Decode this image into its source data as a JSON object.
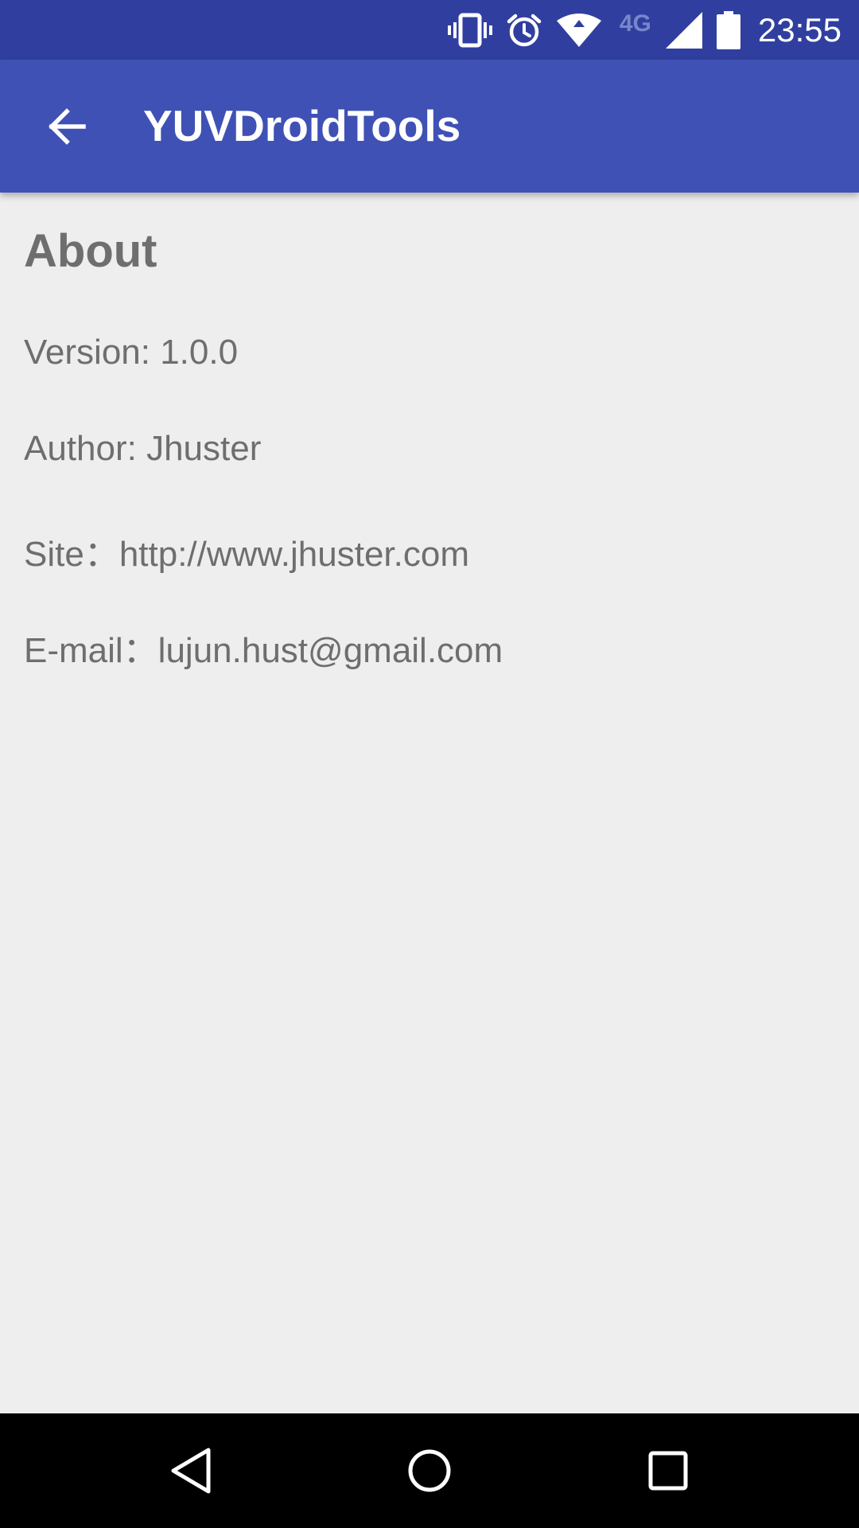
{
  "status_bar": {
    "network_label": "4G",
    "time": "23:55",
    "icons": [
      "vibrate-icon",
      "alarm-icon",
      "wifi-icon",
      "signal-icon",
      "battery-icon"
    ]
  },
  "app_bar": {
    "title": "YUVDroidTools",
    "back_icon": "arrow-back-icon"
  },
  "content": {
    "heading": "About",
    "version": "Version: 1.0.0",
    "author": "Author: Jhuster",
    "site": "Site：http://www.jhuster.com",
    "email": "E-mail：lujun.hust@gmail.com"
  },
  "nav_bar": {
    "icons": [
      "nav-back-icon",
      "nav-home-icon",
      "nav-recents-icon"
    ]
  },
  "colors": {
    "status_bar": "#303f9f",
    "app_bar": "#3f51b5",
    "background": "#eeeeee",
    "text": "#6e6e6e",
    "nav_bar": "#000000"
  }
}
